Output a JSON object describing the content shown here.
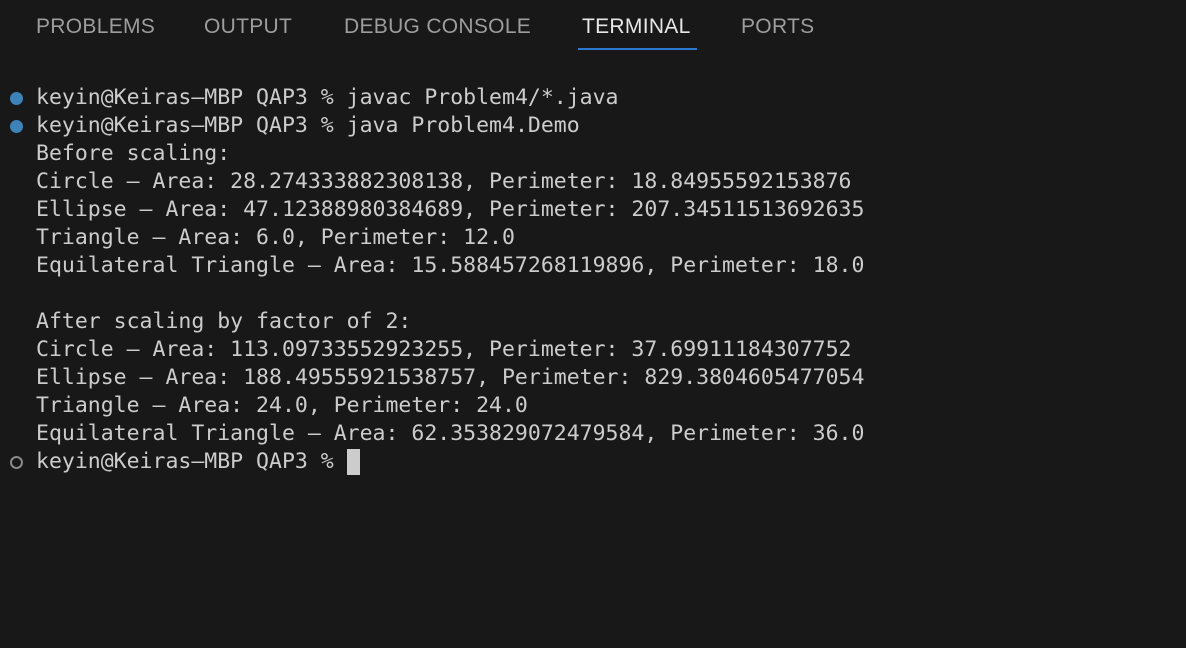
{
  "tabs": [
    {
      "label": "PROBLEMS",
      "active": false
    },
    {
      "label": "OUTPUT",
      "active": false
    },
    {
      "label": "DEBUG CONSOLE",
      "active": false
    },
    {
      "label": "TERMINAL",
      "active": true
    },
    {
      "label": "PORTS",
      "active": false
    }
  ],
  "terminal": {
    "prompt": "keyin@Keiras—MBP QAP3 % ",
    "commands": [
      {
        "text": "javac Problem4/*.java",
        "status": "completed"
      },
      {
        "text": "java Problem4.Demo",
        "status": "completed"
      }
    ],
    "output": [
      "Before scaling:",
      "Circle — Area: 28.274333882308138, Perimeter: 18.84955592153876",
      "Ellipse — Area: 47.12388980384689, Perimeter: 207.34511513692635",
      "Triangle — Area: 6.0, Perimeter: 12.0",
      "Equilateral Triangle — Area: 15.588457268119896, Perimeter: 18.0",
      "",
      "After scaling by factor of 2:",
      "Circle — Area: 113.09733552923255, Perimeter: 37.69911184307752",
      "Ellipse — Area: 188.49555921538757, Perimeter: 829.3804605477054",
      "Triangle — Area: 24.0, Perimeter: 24.0",
      "Equilateral Triangle — Area: 62.353829072479584, Perimeter: 36.0"
    ],
    "current_input": "",
    "colors": {
      "background": "#181818",
      "text": "#cccccc",
      "active_tab_underline": "#2b79d0",
      "success_dot": "#3e83b8"
    }
  }
}
